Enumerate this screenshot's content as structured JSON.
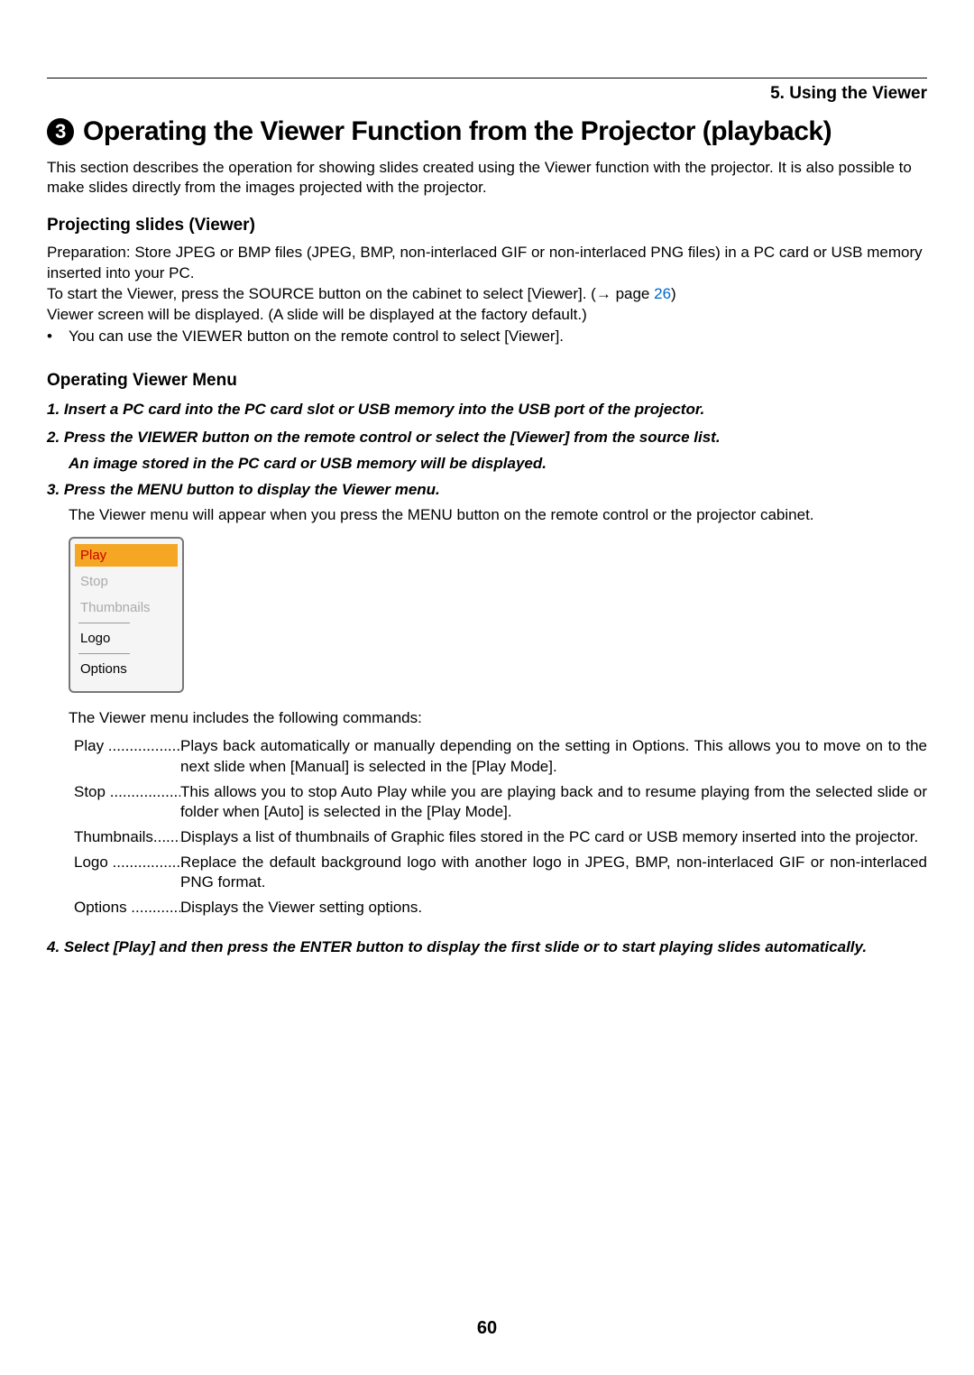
{
  "chapter": "5. Using the Viewer",
  "section_number": "3",
  "section_title": "Operating the Viewer Function from the Projector (playback)",
  "intro": "This section describes the operation for showing slides created using the Viewer function with the projector. It is also possible to make slides directly from the images projected with the projector.",
  "sub1_title": "Projecting slides (Viewer)",
  "sub1_line1": "Preparation: Store JPEG or BMP files (JPEG, BMP, non-interlaced GIF or non-interlaced PNG files) in a PC card or USB memory inserted into your PC.",
  "sub1_line2a": "To start the Viewer, press the SOURCE button on the cabinet to select [Viewer]. (→ page ",
  "sub1_pageref": "26",
  "sub1_line2b": ")",
  "sub1_line3": "Viewer screen will be displayed. (A slide will be displayed at the factory default.)",
  "sub1_bullet": "You can use the VIEWER button on the remote control to select [Viewer].",
  "sub2_title": "Operating Viewer Menu",
  "step1": "1.  Insert a PC card into the PC card slot or USB memory into the USB port of the projector.",
  "step2": "2.  Press the VIEWER button on the remote control or select the [Viewer] from the source list.",
  "step2b": "An image stored in the PC card or USB memory will be displayed.",
  "step3": "3.  Press the MENU button to display the Viewer menu.",
  "step3_note": "The Viewer menu will appear when you press the MENU button on the remote control or the projector cabinet.",
  "menu": {
    "play": "Play",
    "stop": "Stop",
    "thumbnails": "Thumbnails",
    "logo": "Logo",
    "options": "Options"
  },
  "commands_intro": "The Viewer menu includes the following commands:",
  "commands": {
    "play_label": "Play ...................",
    "play_desc": "Plays back automatically or manually depending on the setting in Options. This allows you to move on to the next slide when [Manual] is selected in the [Play Mode].",
    "stop_label": "Stop ...................",
    "stop_desc": "This allows you to stop Auto Play while you are playing back and to resume playing from the selected slide or folder when [Auto] is selected in the [Play Mode].",
    "thumb_label": "Thumbnails........",
    "thumb_desc": "Displays a list of thumbnails of Graphic files stored in the PC card or USB memory inserted into the projector.",
    "logo_label": "Logo ..................",
    "logo_desc": "Replace the default background logo with another logo in JPEG, BMP, non-interlaced GIF or non-interlaced PNG format.",
    "options_label": "Options ..............",
    "options_desc": "Displays the Viewer setting options."
  },
  "step4": "4.  Select [Play] and then press the ENTER button to display the first slide or to start playing slides automatically.",
  "page_number": "60"
}
